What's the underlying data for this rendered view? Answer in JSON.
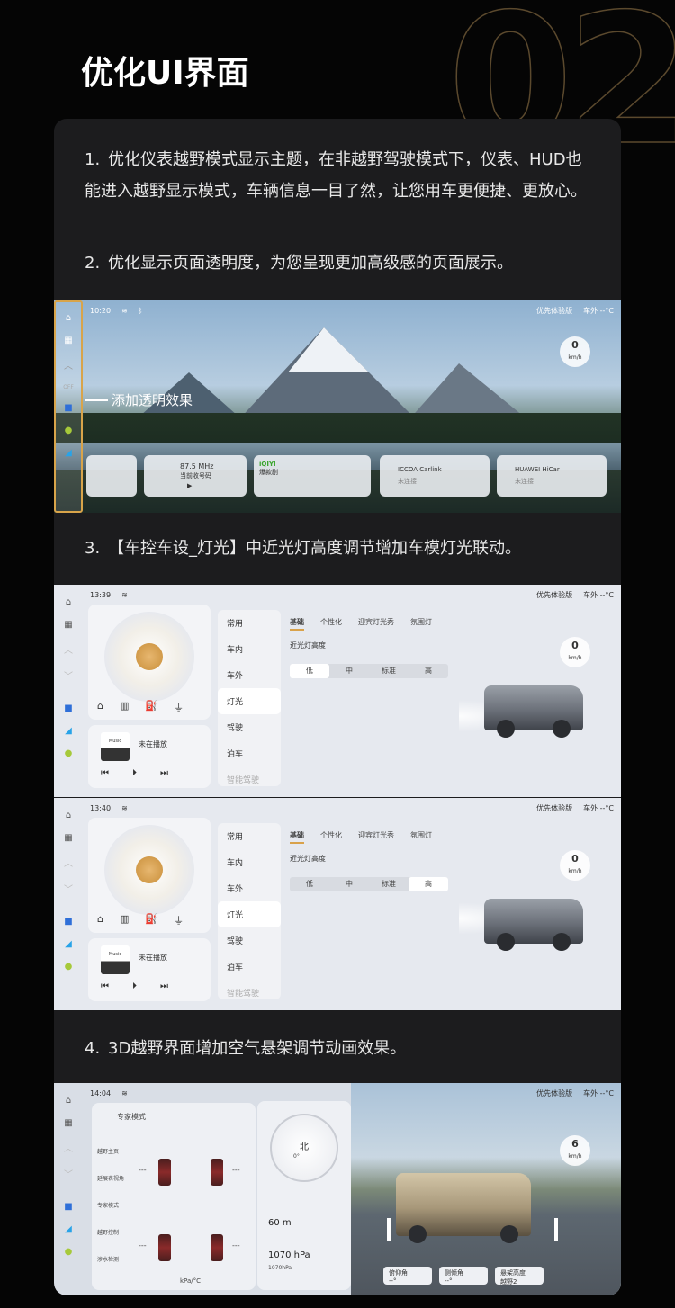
{
  "header": {
    "bg_number": "02",
    "title": "优化UI界面"
  },
  "items": [
    {
      "num": "1.",
      "text": "优化仪表越野模式显示主题，在非越野驾驶模式下，仪表、HUD也能进入越野显示模式，车辆信息一目了然，让您用车更便捷、更放心。"
    },
    {
      "num": "2.",
      "text": "优化显示页面透明度，为您呈现更加高级感的页面展示。"
    },
    {
      "num": "3.",
      "text": "【车控车设_灯光】中近光灯高度调节增加车模灯光联动。"
    },
    {
      "num": "4.",
      "text": "3D越野界面增加空气悬架调节动画效果。"
    }
  ],
  "screen1": {
    "time": "10:20",
    "brand": "优先体验版",
    "outside": "车外 --°C",
    "annotation": "添加透明效果",
    "speed": "0",
    "speed_unit": "km/h",
    "cards": {
      "radio": "87.5 MHz",
      "radio_sub": "当前收号码",
      "iqiyi": "iQIYI",
      "iqiyi_sub": "爆款剧",
      "carlink": "ICCOA Carlink",
      "carlink_sub": "未连接",
      "hicar": "HUAWEI HiCar",
      "hicar_sub": "未连接"
    },
    "side_off": "OFF"
  },
  "screen2": {
    "time": "13:39",
    "brand": "优先体验版",
    "outside": "车外 --°C",
    "speed": "0",
    "speed_unit": "km/h",
    "menu": [
      "常用",
      "车内",
      "车外",
      "灯光",
      "驾驶",
      "泊车",
      "智能驾驶"
    ],
    "tabs": [
      "基础",
      "个性化",
      "迎宾灯光秀",
      "氛围灯"
    ],
    "label": "近光灯高度",
    "levels": [
      "低",
      "中",
      "标准",
      "高"
    ],
    "music_app": "Music",
    "music_status": "未在播放",
    "badge": "0"
  },
  "screen3": {
    "time": "13:40",
    "brand": "优先体验版",
    "outside": "车外 --°C",
    "speed": "0",
    "speed_unit": "km/h",
    "menu": [
      "常用",
      "车内",
      "车外",
      "灯光",
      "驾驶",
      "泊车",
      "智能驾驶"
    ],
    "tabs": [
      "基础",
      "个性化",
      "迎宾灯光秀",
      "氛围灯"
    ],
    "label": "近光灯高度",
    "levels": [
      "低",
      "中",
      "标准",
      "高"
    ],
    "music_app": "Music",
    "music_status": "未在播放",
    "badge": "0"
  },
  "screen4": {
    "time": "14:04",
    "brand": "优先体验版",
    "outside": "车外 --°C",
    "speed": "6",
    "speed_unit": "km/h",
    "expert": "专家模式",
    "modes": [
      "越野主页",
      "延展表视角",
      "专家模式",
      "越野控制",
      "涉水检测"
    ],
    "unit": "kPa/°C",
    "dash": "---",
    "compass_dir": "北",
    "compass_deg": "0°",
    "altitude": "60 m",
    "pressure": "1070 hPa",
    "pressure_sub": "1070hPa",
    "chips": {
      "pitch": "俯仰角",
      "roll": "侧倾角",
      "height": "悬架高度",
      "height_val": "越野2",
      "dash": "--°"
    }
  },
  "colors": {
    "accent": "#d9a24a",
    "card": "#1c1c1e"
  }
}
